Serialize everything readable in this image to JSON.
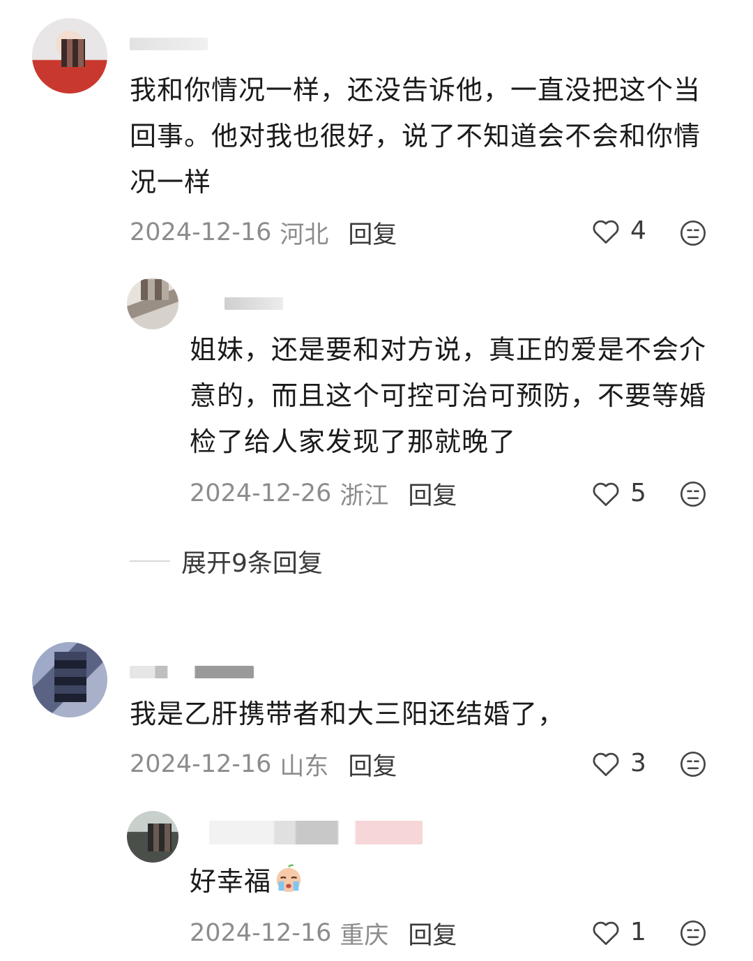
{
  "comments": [
    {
      "text": "我和你情况一样，还没告诉他，一直没把这个当回事。他对我也很好，说了不知道会不会和你情况一样",
      "date": "2024-12-16",
      "location": "河北",
      "reply_label": "回复",
      "likes": "4"
    },
    {
      "text": "姐妹，还是要和对方说，真正的爱是不会介意的，而且这个可控可治可预防，不要等婚检了给人家发现了那就晚了",
      "date": "2024-12-26",
      "location": "浙江",
      "reply_label": "回复",
      "likes": "5"
    },
    {
      "text": "我是乙肝携带者和大三阳还结婚了，",
      "date": "2024-12-16",
      "location": "山东",
      "reply_label": "回复",
      "likes": "3"
    },
    {
      "text": "好幸福",
      "date": "2024-12-16",
      "location": "重庆",
      "reply_label": "回复",
      "likes": "1"
    }
  ],
  "expand_replies": "展开9条回复",
  "icons": {
    "like": "heart-outline-icon",
    "dislike": "unhappy-face-icon",
    "emoji": "crying-emoji"
  }
}
